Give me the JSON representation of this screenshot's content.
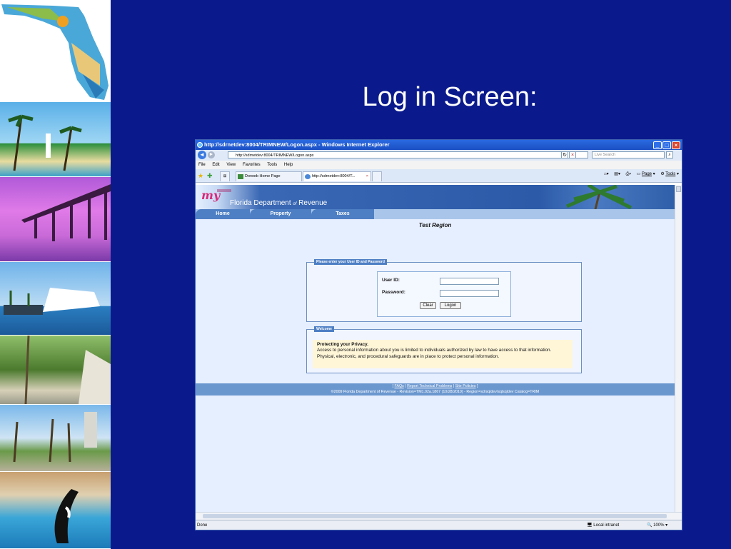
{
  "slide": {
    "title": "Log in Screen:"
  },
  "browser": {
    "window_title": "http://sdrnetdev:8004/TRIMNEW/Logon.aspx - Windows Internet Explorer",
    "address_url": "http://sdrnetdev:8004/TRIMNEW/Logon.aspx",
    "search_placeholder": "Live Search",
    "menu": [
      "File",
      "Edit",
      "View",
      "Favorites",
      "Tools",
      "Help"
    ],
    "tabs": [
      {
        "label": "Dorweb Home Page"
      },
      {
        "label": "http://sdrnetdev:8004/T..."
      }
    ],
    "command_bar": {
      "page_label": "Page",
      "tools_label": "Tools"
    },
    "status": {
      "left": "Done",
      "zone": "Local intranet",
      "zoom": "100%"
    }
  },
  "site": {
    "logo_text": "my",
    "agency_name_part1": "Florida Department",
    "agency_name_of": "of",
    "agency_name_part2": "Revenue",
    "nav": [
      "Home",
      "Property",
      "Taxes"
    ],
    "region_title": "Test Region",
    "login": {
      "legend": "Please enter your User ID and Password",
      "user_id_label": "User ID:",
      "password_label": "Password:",
      "user_id_value": "",
      "password_value": "",
      "clear_button": "Clear",
      "logon_button": "Logon"
    },
    "welcome": {
      "legend": "Welcome",
      "heading": "Protecting your Privacy",
      "text": "Access to personal information about you is limited to individuals authorized by law to have access to that information. Physical, electronic, and procedural safeguards are in place to protect personal information."
    },
    "footer": {
      "links": [
        "FAQs",
        "Report Technical Problems",
        "Site Policies"
      ],
      "copyright": "©2009 Florida Department of Revenue - Revision=TM1.02a.1867 (10/28/2010) - Region=sdrsqldev\\sqlsqldev Catalog=TRIM"
    }
  }
}
